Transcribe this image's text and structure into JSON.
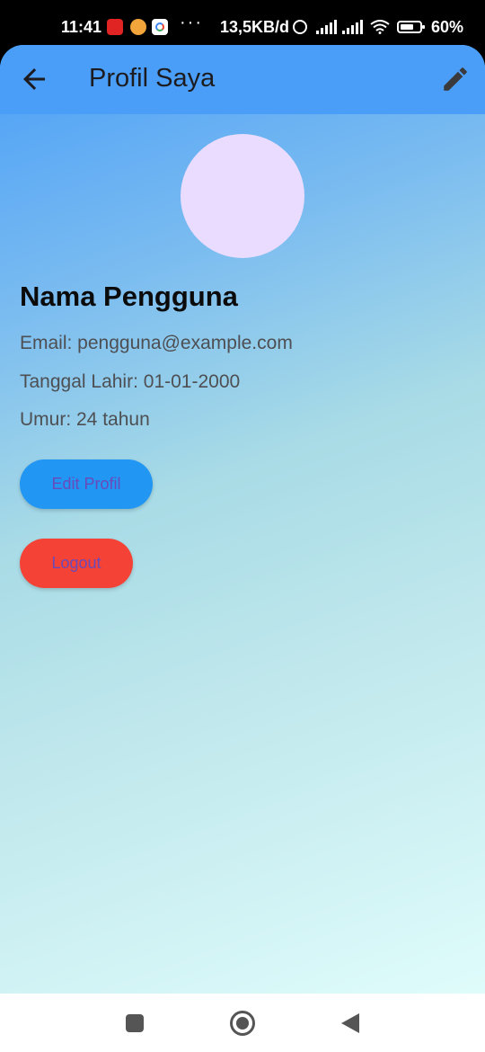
{
  "status_bar": {
    "time": "11:41",
    "dots": "···",
    "network_speed": "13,5KB/d",
    "battery": "60%"
  },
  "app_bar": {
    "title": "Profil Saya",
    "background": "#4a9ef7"
  },
  "profile": {
    "name": "Nama Pengguna",
    "email": "Email: pengguna@example.com",
    "birth_date": "Tanggal Lahir: 01-01-2000",
    "age": "Umur: 24 tahun",
    "avatar_color": "#eadcfe"
  },
  "buttons": {
    "edit_profile": "Edit Profil",
    "logout": "Logout",
    "edit_color": "#2196f3",
    "logout_color": "#f44336",
    "label_color": "#6a4ab9"
  },
  "icons": {
    "back": "arrow-left-icon",
    "edit": "pencil-icon",
    "nav_recents": "square-icon",
    "nav_home": "circle-icon",
    "nav_back": "triangle-left-icon"
  }
}
